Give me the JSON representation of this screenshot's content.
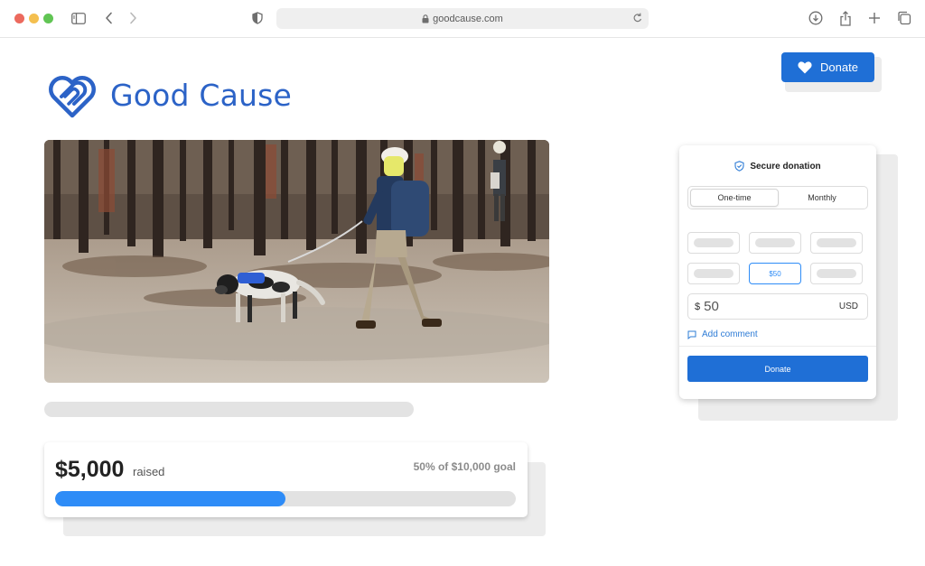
{
  "browser": {
    "url": "goodcause.com"
  },
  "brand": {
    "name": "Good Cause",
    "color": "#2c63c7"
  },
  "header": {
    "donate_label": "Donate"
  },
  "hero": {
    "image_icon": "photo-volunteer-with-dog-in-forest"
  },
  "progress": {
    "raised": "$5,000",
    "raised_label": "raised",
    "goal_text": "50% of $10,000 goal",
    "percent": 0.5,
    "fill_color": "#2e8cf7"
  },
  "widget": {
    "secure_label": "Secure donation",
    "frequency": [
      "One-time",
      "Monthly"
    ],
    "frequency_selected": "One-time",
    "selected_amount_label": "$50",
    "currency_symbol": "$",
    "amount_value": "50",
    "currency_code": "USD",
    "add_comment_label": "Add comment",
    "donate_label": "Donate",
    "accent": "#1f6fd6"
  }
}
